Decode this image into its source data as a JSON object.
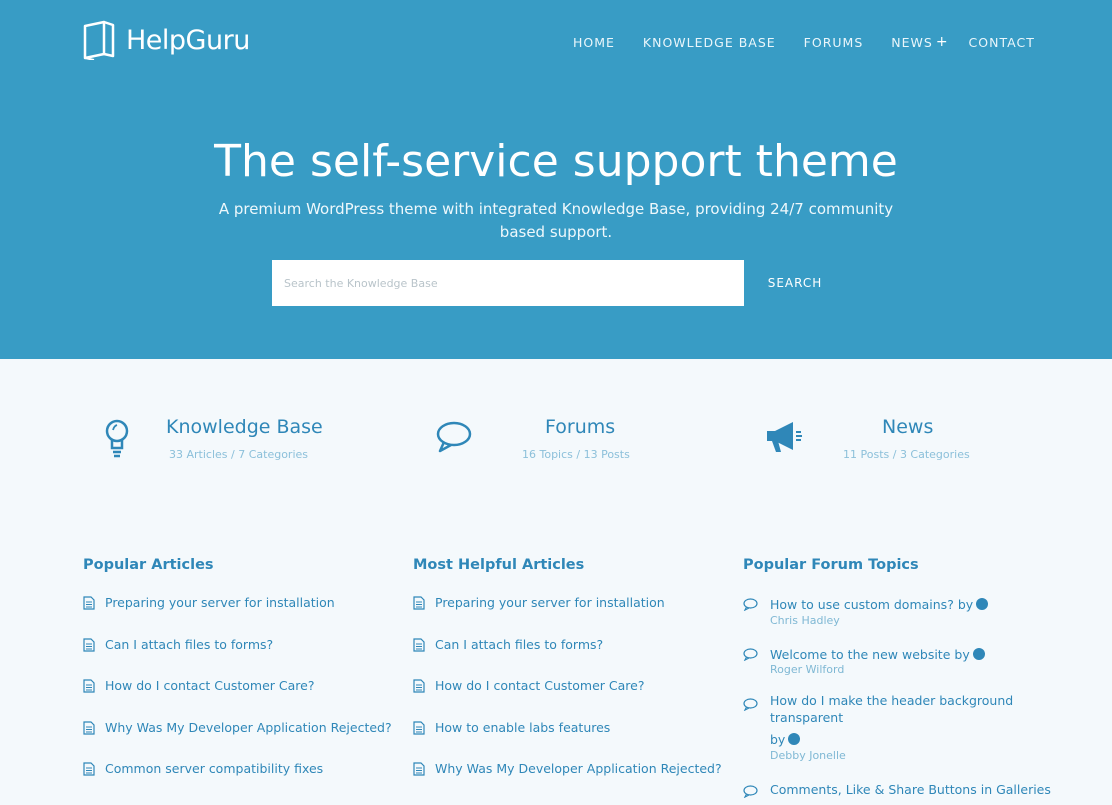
{
  "brand": {
    "name": "HelpGuru"
  },
  "nav": [
    {
      "label": "HOME"
    },
    {
      "label": "KNOWLEDGE BASE"
    },
    {
      "label": "FORUMS"
    },
    {
      "label": "NEWS",
      "has_submenu": true
    },
    {
      "label": "CONTACT"
    }
  ],
  "hero": {
    "title": "The self-service support theme",
    "subtitle": "A premium WordPress theme with integrated Knowledge Base, providing 24/7 community based support.",
    "search_placeholder": "Search the Knowledge Base",
    "search_button": "SEARCH"
  },
  "stats": [
    {
      "title": "Knowledge Base",
      "meta": "33 Articles / 7 Categories",
      "icon": "lightbulb-icon"
    },
    {
      "title": "Forums",
      "meta": "16 Topics / 13 Posts",
      "icon": "speech-bubble-icon"
    },
    {
      "title": "News",
      "meta": "11 Posts / 3 Categories",
      "icon": "megaphone-icon"
    }
  ],
  "popular_articles": {
    "title": "Popular Articles",
    "items": [
      "Preparing your server for installation",
      "Can I attach files to forms?",
      "How do I contact Customer Care?",
      "Why Was My Developer Application Rejected?",
      "Common server compatibility fixes"
    ]
  },
  "helpful_articles": {
    "title": "Most Helpful Articles",
    "items": [
      "Preparing your server for installation",
      "Can I attach files to forms?",
      "How do I contact Customer Care?",
      "How to enable labs features",
      "Why Was My Developer Application Rejected?"
    ]
  },
  "forum_topics": {
    "title": "Popular Forum Topics",
    "by": "by",
    "items": [
      {
        "title": "How to use custom domains?",
        "author": "Chris Hadley"
      },
      {
        "title": "Welcome to the new website",
        "author": "Roger Wilford"
      },
      {
        "title": "How do I make the header background transparent",
        "author": "Debby Jonelle"
      },
      {
        "title": "Comments, Like & Share Buttons in Galleries",
        "author": ""
      }
    ]
  },
  "colors": {
    "hero": "#389cc5",
    "accent": "#2f87b8",
    "page": "#f4f9fc"
  }
}
